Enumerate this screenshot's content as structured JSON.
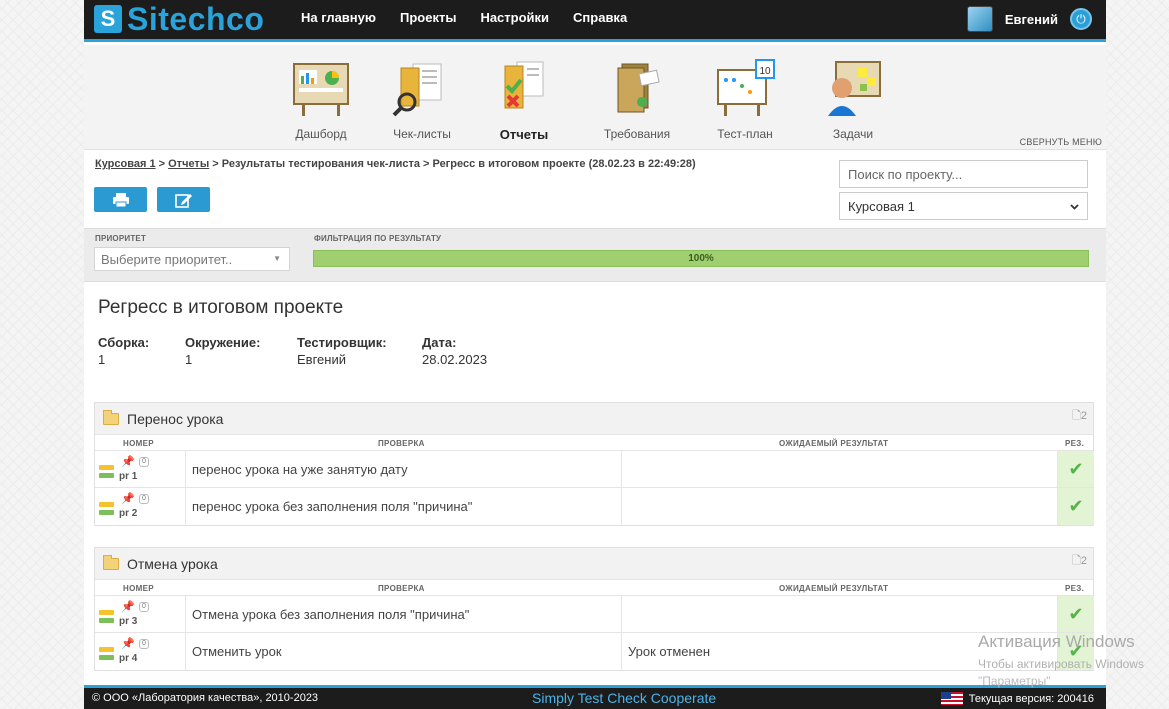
{
  "header": {
    "logo_letter": "S",
    "logo_text": "Sitechco",
    "nav": [
      "На главную",
      "Проекты",
      "Настройки",
      "Справка"
    ],
    "user_name": "Евгений"
  },
  "menu": {
    "items": [
      {
        "label": "Дашборд",
        "icon": "dashboard-icon"
      },
      {
        "label": "Чек-листы",
        "icon": "checklists-icon"
      },
      {
        "label": "Отчеты",
        "icon": "reports-icon",
        "active": true
      },
      {
        "label": "Требования",
        "icon": "requirements-icon"
      },
      {
        "label": "Тест-план",
        "icon": "test-plan-icon"
      },
      {
        "label": "Задачи",
        "icon": "tasks-icon"
      }
    ],
    "collapse_label": "СВЕРНУТЬ МЕНЮ"
  },
  "breadcrumb": {
    "links": [
      "Курсовая 1",
      "Отчеты"
    ],
    "tail": "Результаты тестирования чек-листа > Регресс в итоговом проекте (28.02.23 в 22:49:28)",
    "separator": " > "
  },
  "search": {
    "placeholder": "Поиск по проекту..."
  },
  "project_select": {
    "value": "Курсовая 1"
  },
  "filters": {
    "priority_label": "ПРИОРИТЕТ",
    "priority_placeholder": "Выберите приоритет..",
    "result_label": "ФИЛЬТРАЦИЯ ПО РЕЗУЛЬТАТУ",
    "progress_text": "100%",
    "progress_value": 100
  },
  "report": {
    "title": "Регресс в итоговом проекте",
    "meta": [
      {
        "key": "Сборка:",
        "value": "1"
      },
      {
        "key": "Окружение:",
        "value": "1"
      },
      {
        "key": "Тестировщик:",
        "value": "Евгений"
      },
      {
        "key": "Дата:",
        "value": "28.02.2023"
      }
    ]
  },
  "columns": {
    "num": "НОМЕР",
    "check": "ПРОВЕРКА",
    "expected": "ОЖИДАЕМЫЙ РЕЗУЛЬТАТ",
    "result": "РЕЗ."
  },
  "sections": [
    {
      "title": "Перенос урока",
      "count": "2",
      "rows": [
        {
          "id": "pr 1",
          "zero": "0",
          "check": "перенос урока на уже занятую дату",
          "expected": "",
          "result": "✔"
        },
        {
          "id": "pr 2",
          "zero": "0",
          "check": "перенос урока без заполнения поля \"причина\"",
          "expected": "",
          "result": "✔"
        }
      ]
    },
    {
      "title": "Отмена урока",
      "count": "2",
      "rows": [
        {
          "id": "pr 3",
          "zero": "0",
          "check": "Отмена урока без заполнения поля \"причина\"",
          "expected": "",
          "result": "✔"
        },
        {
          "id": "pr 4",
          "zero": "0",
          "check": "Отменить урок",
          "expected": "Урок отменен",
          "result": "✔"
        }
      ]
    }
  ],
  "footer": {
    "copyright": "© ООО «Лаборатория качества», 2010-2023",
    "slogan": "Simply Test Check Cooperate",
    "version": "Текущая версия: 200416"
  },
  "watermark": {
    "title": "Активация Windows",
    "subtitle": "Чтобы активировать Windows",
    "subtitle2": "\"Параметры\""
  },
  "colors": {
    "accent": "#29a3d9",
    "topbar": "#1c1c1c",
    "success": "#56b34a",
    "progress": "#9fcf6e"
  }
}
